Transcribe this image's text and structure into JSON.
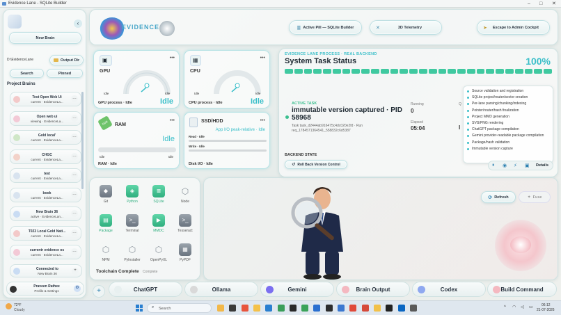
{
  "window": {
    "title": "Evidence Lane - SQLite Builder",
    "controls": [
      "–",
      "□",
      "✕"
    ]
  },
  "sidebar": {
    "new_brain": "New Brain",
    "path": "D:\\EvidenceLane",
    "output_dir": "Output Dir",
    "search": "Search",
    "pinned": "Pinned",
    "section": "Project Brains",
    "items": [
      {
        "title": "Test Open Web Ui",
        "sub": "current · EvidenceLa...",
        "color": "#f3c9c9"
      },
      {
        "title": "Open web ui",
        "sub": "viewing · EvidenceLa...",
        "color": "#f3c9d6"
      },
      {
        "title": "Gold local'",
        "sub": "current · EvidenceLa...",
        "color": "#cfe7c7"
      },
      {
        "title": "CHGC",
        "sub": "current · EvidenceLa...",
        "color": "#f3d2c9"
      },
      {
        "title": "test",
        "sub": "current · EvidenceLa...",
        "color": "#d8e3ef"
      },
      {
        "title": "book",
        "sub": "current · EvidenceLa...",
        "color": "#d8e3ef"
      },
      {
        "title": "New Brain 36",
        "sub": "active · EvidenceLan...",
        "color": "#c9dcf3"
      },
      {
        "title": "T023 Local Gold Nati...",
        "sub": "current · EvidenceLa...",
        "color": "#f3c9c9"
      },
      {
        "title": "currentr evidence os",
        "sub": "current · EvidenceLa...",
        "color": "#f3c9d6"
      }
    ],
    "connected_line1": "Connected to",
    "connected_line2": "New Brain 36",
    "user_name": "Praveen Rathee",
    "user_sub": "Profile & Settings"
  },
  "header": {
    "logo_text": "EVIDENCE",
    "active_pill": "Active Pill — SQLite Builder",
    "telemetry": "3D Telemetry",
    "escape": "Escape to Admin Cockpit"
  },
  "resources": {
    "gpu": {
      "name": "GPU",
      "min": "Idle",
      "max": "Idle",
      "process": "GPU process · Idle",
      "state": "Idle"
    },
    "cpu": {
      "name": "CPU",
      "min": "Idle",
      "max": "Idle",
      "process": "CPU process · Idle",
      "state": "Idle"
    },
    "ram": {
      "name": "RAM",
      "badge": "DDR",
      "state": "Idle",
      "min": "Idle",
      "max": "Idle",
      "process": "RAM · Idle"
    },
    "disk": {
      "name": "SSD/HDD",
      "sub": "App I/O peak-relative · Idle",
      "read": "Read · Idle",
      "write": "Write · Idle",
      "process": "Disk I/O · Idle"
    }
  },
  "status": {
    "process_label": "EVIDENCE LANE PROCESS · REAL BACKEND",
    "title": "System Task Status",
    "percent": "100%",
    "progress": 1.0,
    "segments": 28,
    "active_task_label": "ACTIVE TASK",
    "task_title": "immutable version captured · PID 58968",
    "task_id": "Task task_d2444ab916475c4dc020e2fd · Run",
    "req_id": "req_1784571364541_558832c6d5387",
    "running_label": "Running",
    "running_value": "0",
    "elapsed_label": "Elapsed",
    "elapsed_value": "05:04",
    "extra_label": "Q",
    "extra_value": "I",
    "backend_state_label": "BACKEND STATE",
    "rollback": "Roll Back Version Control",
    "details": "Details",
    "checklist": [
      "Source validation and registration",
      "SQLite project/router/sector creation",
      "Per-lane parsing/chunking/indexing",
      "Pointer/router/hash finalization",
      "Project MMD generation",
      "SVG/PNG rendering",
      "ChatGPT package compilation",
      "Gemini provider-readable package compilation",
      "Package/hash validation",
      "Immutable version capture"
    ]
  },
  "toolchain": {
    "tools": [
      {
        "name": "Git",
        "color": "#7a8490",
        "active": false
      },
      {
        "name": "Python",
        "color": "#3fbf8f",
        "active": true
      },
      {
        "name": "SQLite",
        "color": "#3fbf8f",
        "active": true
      },
      {
        "name": "Node",
        "color": "#9aa3ab",
        "active": false
      },
      {
        "name": "Package",
        "color": "#3fbf8f",
        "active": true
      },
      {
        "name": "Terminal",
        "color": "#6a7480",
        "active": false
      },
      {
        "name": "MMDC",
        "color": "#3fbf8f",
        "active": true
      },
      {
        "name": "Tesseract",
        "color": "#6a7480",
        "active": false
      },
      {
        "name": "NPM",
        "color": "#9aa3ab",
        "active": false
      },
      {
        "name": "PyInstaller",
        "color": "#9aa3ab",
        "active": false
      },
      {
        "name": "OpenPyXL",
        "color": "#9aa3ab",
        "active": false
      },
      {
        "name": "PyPDF",
        "color": "#9aa3ab",
        "active": false
      }
    ],
    "title": "Toolchain Complete",
    "status": "Complete"
  },
  "stage": {
    "refresh": "Refresh",
    "fuse": "Fuse"
  },
  "bottom": {
    "plus": "+",
    "buttons": [
      "ChatGPT",
      "Ollama",
      "Gemini",
      "Brain Output",
      "Codex",
      "Build Command"
    ]
  },
  "taskbar": {
    "weather_temp": "72°F",
    "weather_desc": "Cloudy",
    "search": "Search",
    "time": "06:12",
    "date": "21-07-2026"
  }
}
